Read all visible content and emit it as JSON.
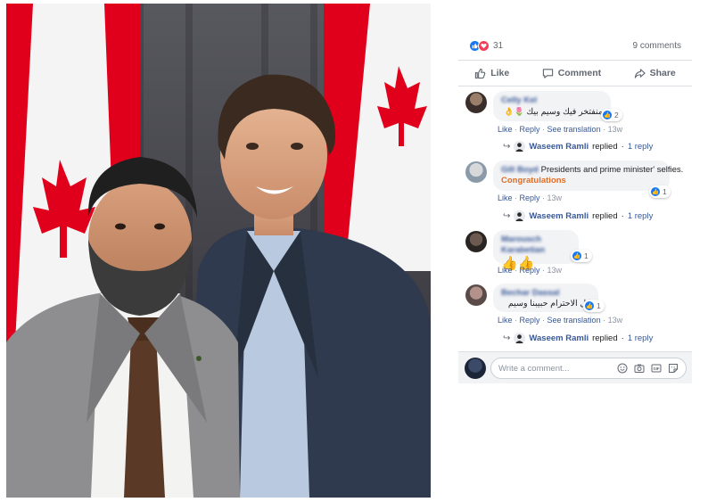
{
  "photo": {
    "alt": "photo"
  },
  "post": {
    "reaction_icons": [
      "like-icon",
      "love-icon"
    ],
    "reaction_count": "31",
    "comments_count": "9 comments",
    "actions": {
      "like": "Like",
      "comment": "Comment",
      "share": "Share"
    }
  },
  "comments": [
    {
      "name": "Celly Kel",
      "text": "منفتخر فيك وسيم بيك",
      "reaction_count": "2",
      "actions": {
        "like": "Like",
        "reply": "Reply",
        "translate": "See translation",
        "time": "13w"
      },
      "reply": {
        "name": "Waseem Ramli",
        "verb": "replied",
        "count": "1 reply"
      }
    },
    {
      "name": "Gill Boyd",
      "text": "Presidents and prime minister' selfies.",
      "highlight": "Congratulations",
      "reaction_count": "1",
      "actions": {
        "like": "Like",
        "reply": "Reply",
        "time": "13w"
      },
      "reply": {
        "name": "Waseem Ramli",
        "verb": "replied",
        "count": "1 reply"
      }
    },
    {
      "name": "Marousch Karabetian",
      "text": "👍👍",
      "reaction_count": "1",
      "actions": {
        "like": "Like",
        "reply": "Reply",
        "time": "13w"
      }
    },
    {
      "name": "Bechar Dassal",
      "text": "كل الاحترام حبيبنا وسيم",
      "reaction_count": "1",
      "actions": {
        "like": "Like",
        "reply": "Reply",
        "translate": "See translation",
        "time": "13w"
      },
      "reply": {
        "name": "Waseem Ramli",
        "verb": "replied",
        "count": "1 reply"
      }
    }
  ],
  "composer": {
    "placeholder": "Write a comment...",
    "tools": [
      "emoji-icon",
      "camera-icon",
      "gif-icon",
      "sticker-icon"
    ]
  },
  "colors": {
    "facebook_blue": "#1877f2",
    "link_blue": "#385898",
    "love_red": "#f33e58",
    "accent_orange": "#e36c1e",
    "bubble_grey": "#f2f3f5",
    "flag_red": "#e0001b"
  }
}
